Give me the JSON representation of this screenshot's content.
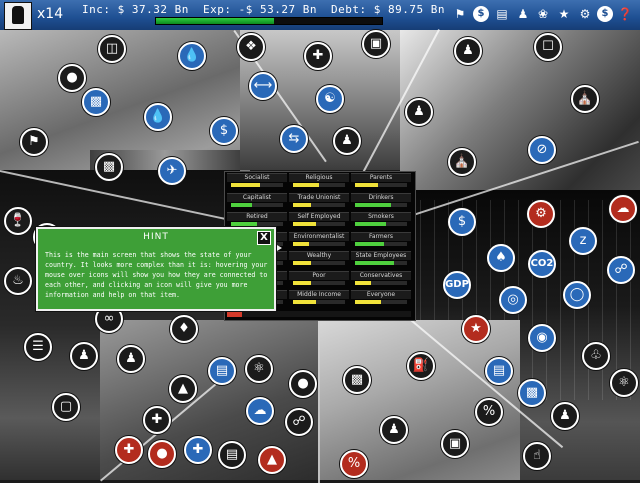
{
  "status": {
    "turns": "x14",
    "income": "Inc: $ 37.32 Bn",
    "expenses": "Exp: -$ 53.27 Bn",
    "debt": "Debt: $ 89.75 Bn",
    "budget_fill": 0.52
  },
  "toolbar_icons": [
    "policy-icon",
    "tax-icon",
    "finance-icon",
    "voters-icon",
    "awards-icon",
    "achievements-icon",
    "settings-icon",
    "money-icon",
    "hint-icon",
    "save-icon",
    "load-icon",
    "quit-icon"
  ],
  "voter_groups": [
    {
      "label": "Socialist",
      "value": 0.55,
      "color": "#f0e23a"
    },
    {
      "label": "Religious",
      "value": 0.5,
      "color": "#f0e23a"
    },
    {
      "label": "Parents",
      "value": 0.45,
      "color": "#f0e23a"
    },
    {
      "label": "Capitalist",
      "value": 0.4,
      "color": "#4fd03e"
    },
    {
      "label": "Trade Unionist",
      "value": 0.35,
      "color": "#f0e23a"
    },
    {
      "label": "Drinkers",
      "value": 0.7,
      "color": "#4fd03e"
    },
    {
      "label": "Retired",
      "value": 0.5,
      "color": "#4fd03e"
    },
    {
      "label": "Self Employed",
      "value": 0.45,
      "color": "#f0e23a"
    },
    {
      "label": "Smokers",
      "value": 0.6,
      "color": "#4fd03e"
    },
    {
      "label": "Commuter",
      "value": 0.4,
      "color": "#f0e23a"
    },
    {
      "label": "Environmentalist",
      "value": 0.3,
      "color": "#f0e23a"
    },
    {
      "label": "Farmers",
      "value": 0.55,
      "color": "#4fd03e"
    },
    {
      "label": "Young",
      "value": 0.4,
      "color": "#f0e23a"
    },
    {
      "label": "Wealthy",
      "value": 0.35,
      "color": "#f0e23a"
    },
    {
      "label": "State Employees",
      "value": 0.75,
      "color": "#4fd03e"
    },
    {
      "label": "Motorist",
      "value": 0.45,
      "color": "#f0e23a"
    },
    {
      "label": "Poor",
      "value": 0.35,
      "color": "#f0e23a"
    },
    {
      "label": "Conservatives",
      "value": 0.3,
      "color": "#f0e23a"
    },
    {
      "label": "Liberal",
      "value": 0.4,
      "color": "#f0e23a"
    },
    {
      "label": "Middle Income",
      "value": 0.45,
      "color": "#f0e23a"
    },
    {
      "label": "Everyone",
      "value": 0.5,
      "color": "#f0e23a"
    }
  ],
  "overall_approval": 0.08,
  "hint": {
    "title": "HINT",
    "close": "X",
    "text": "This is the main screen that shows the state of your country. It looks more complex than it is: hovering your mouse over icons will show you how they are connected to each other, and clicking an icon will give you more information and help on that item."
  },
  "map_icons": {
    "transport": [
      "bus-lane-icon",
      "car-icon",
      "water-icon",
      "pollution-icon",
      "airport-icon",
      "cycling-icon",
      "bus-icon",
      "fuel-tax-icon"
    ],
    "defense": [
      "military-icon",
      "arms-dealing-icon",
      "religion-icon",
      "trade-icon",
      "police-icon"
    ],
    "welfare": [
      "elderly-icon",
      "housing-icon",
      "unemployment-icon",
      "homeless-icon",
      "disabled-icon",
      "poverty-icon"
    ],
    "law": [
      "alcohol-icon",
      "crime-icon",
      "courts-icon",
      "prison-icon",
      "drugs-icon",
      "gun-icon",
      "handcuffs-icon"
    ],
    "economy": [
      "investment-icon",
      "industry-icon",
      "sleep-icon",
      "gdp-icon",
      "co2-icon",
      "charity-icon",
      "coins-icon",
      "pills-icon",
      "lightbulb-icon",
      "internet-icon",
      "stock-icon",
      "technology-icon"
    ],
    "public": [
      "education-icon",
      "health-icon",
      "hospital-icon",
      "science-icon",
      "weather-icon",
      "fish-icon",
      "network-icon",
      "germ-icon",
      "fire-icon",
      "car-pool-icon",
      "gas-icon",
      "tax-percent-icon",
      "sale-icon",
      "doctor-icon",
      "touch-icon"
    ],
    "gdp_label": "GDP",
    "co2_label": "CO2"
  }
}
